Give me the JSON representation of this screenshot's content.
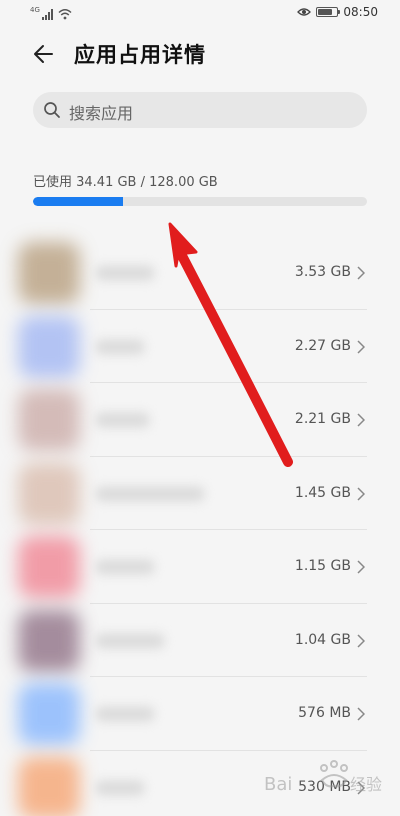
{
  "status_bar": {
    "network_label": "4G",
    "time": "08:50",
    "battery_level": 0.7,
    "icons": [
      "signal-icon",
      "wifi-icon",
      "eye-comfort-icon",
      "battery-icon"
    ]
  },
  "header": {
    "title": "应用占用详情",
    "back_icon": "arrow-left-icon"
  },
  "search": {
    "placeholder": "搜索应用",
    "icon": "search-icon"
  },
  "storage": {
    "summary": "已使用 34.41 GB / 128.00 GB",
    "used_gb": 34.41,
    "total_gb": 128.0,
    "bar_color": "#1a7cf0",
    "track_color": "#e3e3e3"
  },
  "apps": [
    {
      "size": "3.53 GB",
      "icon_color": "#b49a78"
    },
    {
      "size": "2.27 GB",
      "icon_color": "#9db3f3"
    },
    {
      "size": "2.21 GB",
      "icon_color": "#c9a8a4"
    },
    {
      "size": "1.45 GB",
      "icon_color": "#d8b9a9"
    },
    {
      "size": "1.15 GB",
      "icon_color": "#f07f8e"
    },
    {
      "size": "1.04 GB",
      "icon_color": "#8a6a80"
    },
    {
      "size": "576 MB",
      "icon_color": "#7fb2ff"
    },
    {
      "size": "530 MB",
      "icon_color": "#f6a06b"
    }
  ],
  "annotation": {
    "arrow_color": "#e11d1d"
  }
}
